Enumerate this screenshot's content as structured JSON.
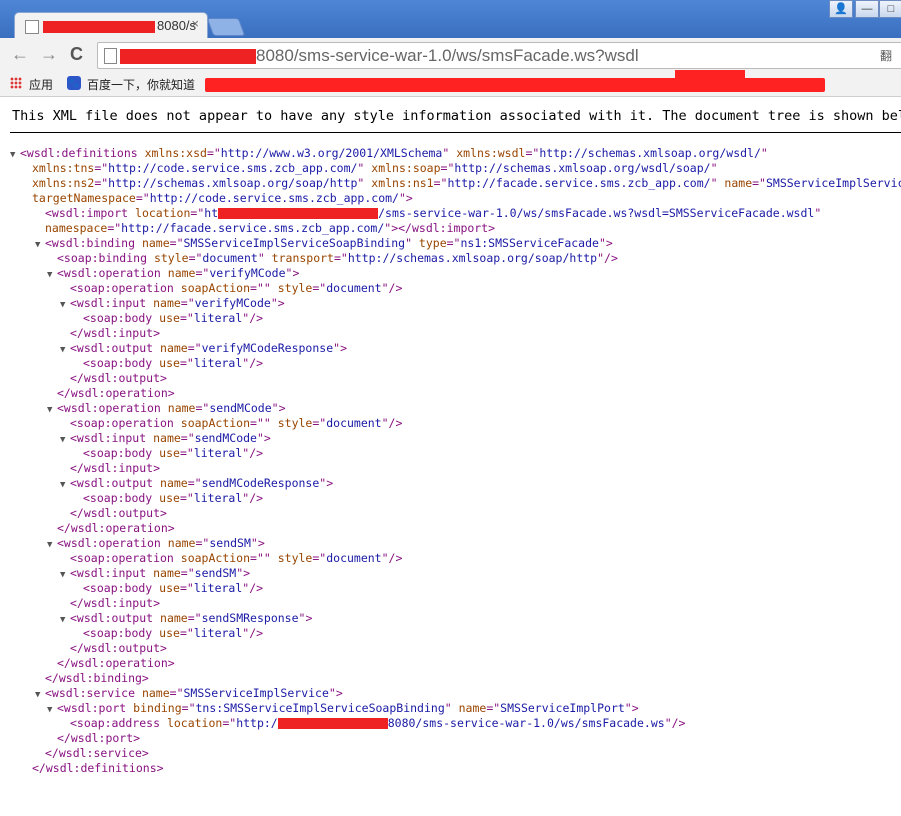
{
  "tab": {
    "title_suffix": "8080/s",
    "close": "×"
  },
  "window": {
    "user": "👤",
    "minimize": "—",
    "restore": "□"
  },
  "nav": {
    "back": "←",
    "forward": "→",
    "reload": "C"
  },
  "address": {
    "url_suffix": "8080/sms-service-war-1.0/ws/smsFacade.ws?wsdl",
    "translate_icon": "翻"
  },
  "bookmarks": {
    "apps_label": "应用",
    "baidu_label": "百度一下，你就知道"
  },
  "notice": "This XML file does not appear to have any style information associated with it. The document tree is shown below.",
  "xml": [
    {
      "indent": 0,
      "twisty": "▼",
      "parts": [
        [
          "tag",
          "<wsdl:definitions "
        ],
        [
          "attr",
          "xmlns:xsd"
        ],
        [
          "tag",
          "=\""
        ],
        [
          "val",
          "http://www.w3.org/2001/XMLSchema"
        ],
        [
          "tag",
          "\" "
        ],
        [
          "attr",
          "xmlns:wsdl"
        ],
        [
          "tag",
          "=\""
        ],
        [
          "val",
          "http://schemas.xmlsoap.org/wsdl/"
        ],
        [
          "tag",
          "\""
        ]
      ]
    },
    {
      "indent": 1,
      "twisty": "",
      "parts": [
        [
          "attr",
          "xmlns:tns"
        ],
        [
          "tag",
          "=\""
        ],
        [
          "val",
          "http://code.service.sms.zcb_app.com/"
        ],
        [
          "tag",
          "\" "
        ],
        [
          "attr",
          "xmlns:soap"
        ],
        [
          "tag",
          "=\""
        ],
        [
          "val",
          "http://schemas.xmlsoap.org/wsdl/soap/"
        ],
        [
          "tag",
          "\""
        ]
      ]
    },
    {
      "indent": 1,
      "twisty": "",
      "parts": [
        [
          "attr",
          "xmlns:ns2"
        ],
        [
          "tag",
          "=\""
        ],
        [
          "val",
          "http://schemas.xmlsoap.org/soap/http"
        ],
        [
          "tag",
          "\" "
        ],
        [
          "attr",
          "xmlns:ns1"
        ],
        [
          "tag",
          "=\""
        ],
        [
          "val",
          "http://facade.service.sms.zcb_app.com/"
        ],
        [
          "tag",
          "\" "
        ],
        [
          "attr",
          "name"
        ],
        [
          "tag",
          "=\""
        ],
        [
          "val",
          "SMSServiceImplService"
        ],
        [
          "tag",
          "\""
        ]
      ]
    },
    {
      "indent": 1,
      "twisty": "",
      "parts": [
        [
          "attr",
          "targetNamespace"
        ],
        [
          "tag",
          "=\""
        ],
        [
          "val",
          "http://code.service.sms.zcb_app.com/"
        ],
        [
          "tag",
          "\">"
        ]
      ]
    },
    {
      "indent": 2,
      "twisty": "",
      "parts": [
        [
          "tag",
          "<wsdl:import "
        ],
        [
          "attr",
          "location"
        ],
        [
          "tag",
          "=\""
        ],
        [
          "val",
          "ht"
        ],
        [
          "red",
          ""
        ],
        [
          "val",
          "/sms-service-war-1.0/ws/smsFacade.ws?wsdl=SMSServiceFacade.wsdl"
        ],
        [
          "tag",
          "\""
        ]
      ]
    },
    {
      "indent": 2,
      "twisty": "",
      "parts": [
        [
          "attr",
          "namespace"
        ],
        [
          "tag",
          "=\""
        ],
        [
          "val",
          "http://facade.service.sms.zcb_app.com/"
        ],
        [
          "tag",
          "\"></wsdl:import>"
        ]
      ]
    },
    {
      "indent": 2,
      "twisty": "▼",
      "parts": [
        [
          "tag",
          "<wsdl:binding "
        ],
        [
          "attr",
          "name"
        ],
        [
          "tag",
          "=\""
        ],
        [
          "val",
          "SMSServiceImplServiceSoapBinding"
        ],
        [
          "tag",
          "\" "
        ],
        [
          "attr",
          "type"
        ],
        [
          "tag",
          "=\""
        ],
        [
          "val",
          "ns1:SMSServiceFacade"
        ],
        [
          "tag",
          "\">"
        ]
      ]
    },
    {
      "indent": 3,
      "twisty": "",
      "parts": [
        [
          "tag",
          "<soap:binding "
        ],
        [
          "attr",
          "style"
        ],
        [
          "tag",
          "=\""
        ],
        [
          "val",
          "document"
        ],
        [
          "tag",
          "\" "
        ],
        [
          "attr",
          "transport"
        ],
        [
          "tag",
          "=\""
        ],
        [
          "val",
          "http://schemas.xmlsoap.org/soap/http"
        ],
        [
          "tag",
          "\"/>"
        ]
      ]
    },
    {
      "indent": 3,
      "twisty": "▼",
      "parts": [
        [
          "tag",
          "<wsdl:operation "
        ],
        [
          "attr",
          "name"
        ],
        [
          "tag",
          "=\""
        ],
        [
          "val",
          "verifyMCode"
        ],
        [
          "tag",
          "\">"
        ]
      ]
    },
    {
      "indent": 4,
      "twisty": "",
      "parts": [
        [
          "tag",
          "<soap:operation "
        ],
        [
          "attr",
          "soapAction"
        ],
        [
          "tag",
          "=\"\" "
        ],
        [
          "attr",
          "style"
        ],
        [
          "tag",
          "=\""
        ],
        [
          "val",
          "document"
        ],
        [
          "tag",
          "\"/>"
        ]
      ]
    },
    {
      "indent": 4,
      "twisty": "▼",
      "parts": [
        [
          "tag",
          "<wsdl:input "
        ],
        [
          "attr",
          "name"
        ],
        [
          "tag",
          "=\""
        ],
        [
          "val",
          "verifyMCode"
        ],
        [
          "tag",
          "\">"
        ]
      ]
    },
    {
      "indent": 5,
      "twisty": "",
      "parts": [
        [
          "tag",
          "<soap:body "
        ],
        [
          "attr",
          "use"
        ],
        [
          "tag",
          "=\""
        ],
        [
          "val",
          "literal"
        ],
        [
          "tag",
          "\"/>"
        ]
      ]
    },
    {
      "indent": 4,
      "twisty": "",
      "parts": [
        [
          "tag",
          "</wsdl:input>"
        ]
      ]
    },
    {
      "indent": 4,
      "twisty": "▼",
      "parts": [
        [
          "tag",
          "<wsdl:output "
        ],
        [
          "attr",
          "name"
        ],
        [
          "tag",
          "=\""
        ],
        [
          "val",
          "verifyMCodeResponse"
        ],
        [
          "tag",
          "\">"
        ]
      ]
    },
    {
      "indent": 5,
      "twisty": "",
      "parts": [
        [
          "tag",
          "<soap:body "
        ],
        [
          "attr",
          "use"
        ],
        [
          "tag",
          "=\""
        ],
        [
          "val",
          "literal"
        ],
        [
          "tag",
          "\"/>"
        ]
      ]
    },
    {
      "indent": 4,
      "twisty": "",
      "parts": [
        [
          "tag",
          "</wsdl:output>"
        ]
      ]
    },
    {
      "indent": 3,
      "twisty": "",
      "parts": [
        [
          "tag",
          "</wsdl:operation>"
        ]
      ]
    },
    {
      "indent": 3,
      "twisty": "▼",
      "parts": [
        [
          "tag",
          "<wsdl:operation "
        ],
        [
          "attr",
          "name"
        ],
        [
          "tag",
          "=\""
        ],
        [
          "val",
          "sendMCode"
        ],
        [
          "tag",
          "\">"
        ]
      ]
    },
    {
      "indent": 4,
      "twisty": "",
      "parts": [
        [
          "tag",
          "<soap:operation "
        ],
        [
          "attr",
          "soapAction"
        ],
        [
          "tag",
          "=\"\" "
        ],
        [
          "attr",
          "style"
        ],
        [
          "tag",
          "=\""
        ],
        [
          "val",
          "document"
        ],
        [
          "tag",
          "\"/>"
        ]
      ]
    },
    {
      "indent": 4,
      "twisty": "▼",
      "parts": [
        [
          "tag",
          "<wsdl:input "
        ],
        [
          "attr",
          "name"
        ],
        [
          "tag",
          "=\""
        ],
        [
          "val",
          "sendMCode"
        ],
        [
          "tag",
          "\">"
        ]
      ]
    },
    {
      "indent": 5,
      "twisty": "",
      "parts": [
        [
          "tag",
          "<soap:body "
        ],
        [
          "attr",
          "use"
        ],
        [
          "tag",
          "=\""
        ],
        [
          "val",
          "literal"
        ],
        [
          "tag",
          "\"/>"
        ]
      ]
    },
    {
      "indent": 4,
      "twisty": "",
      "parts": [
        [
          "tag",
          "</wsdl:input>"
        ]
      ]
    },
    {
      "indent": 4,
      "twisty": "▼",
      "parts": [
        [
          "tag",
          "<wsdl:output "
        ],
        [
          "attr",
          "name"
        ],
        [
          "tag",
          "=\""
        ],
        [
          "val",
          "sendMCodeResponse"
        ],
        [
          "tag",
          "\">"
        ]
      ]
    },
    {
      "indent": 5,
      "twisty": "",
      "parts": [
        [
          "tag",
          "<soap:body "
        ],
        [
          "attr",
          "use"
        ],
        [
          "tag",
          "=\""
        ],
        [
          "val",
          "literal"
        ],
        [
          "tag",
          "\"/>"
        ]
      ]
    },
    {
      "indent": 4,
      "twisty": "",
      "parts": [
        [
          "tag",
          "</wsdl:output>"
        ]
      ]
    },
    {
      "indent": 3,
      "twisty": "",
      "parts": [
        [
          "tag",
          "</wsdl:operation>"
        ]
      ]
    },
    {
      "indent": 3,
      "twisty": "▼",
      "parts": [
        [
          "tag",
          "<wsdl:operation "
        ],
        [
          "attr",
          "name"
        ],
        [
          "tag",
          "=\""
        ],
        [
          "val",
          "sendSM"
        ],
        [
          "tag",
          "\">"
        ]
      ]
    },
    {
      "indent": 4,
      "twisty": "",
      "parts": [
        [
          "tag",
          "<soap:operation "
        ],
        [
          "attr",
          "soapAction"
        ],
        [
          "tag",
          "=\"\" "
        ],
        [
          "attr",
          "style"
        ],
        [
          "tag",
          "=\""
        ],
        [
          "val",
          "document"
        ],
        [
          "tag",
          "\"/>"
        ]
      ]
    },
    {
      "indent": 4,
      "twisty": "▼",
      "parts": [
        [
          "tag",
          "<wsdl:input "
        ],
        [
          "attr",
          "name"
        ],
        [
          "tag",
          "=\""
        ],
        [
          "val",
          "sendSM"
        ],
        [
          "tag",
          "\">"
        ]
      ]
    },
    {
      "indent": 5,
      "twisty": "",
      "parts": [
        [
          "tag",
          "<soap:body "
        ],
        [
          "attr",
          "use"
        ],
        [
          "tag",
          "=\""
        ],
        [
          "val",
          "literal"
        ],
        [
          "tag",
          "\"/>"
        ]
      ]
    },
    {
      "indent": 4,
      "twisty": "",
      "parts": [
        [
          "tag",
          "</wsdl:input>"
        ]
      ]
    },
    {
      "indent": 4,
      "twisty": "▼",
      "parts": [
        [
          "tag",
          "<wsdl:output "
        ],
        [
          "attr",
          "name"
        ],
        [
          "tag",
          "=\""
        ],
        [
          "val",
          "sendSMResponse"
        ],
        [
          "tag",
          "\">"
        ]
      ]
    },
    {
      "indent": 5,
      "twisty": "",
      "parts": [
        [
          "tag",
          "<soap:body "
        ],
        [
          "attr",
          "use"
        ],
        [
          "tag",
          "=\""
        ],
        [
          "val",
          "literal"
        ],
        [
          "tag",
          "\"/>"
        ]
      ]
    },
    {
      "indent": 4,
      "twisty": "",
      "parts": [
        [
          "tag",
          "</wsdl:output>"
        ]
      ]
    },
    {
      "indent": 3,
      "twisty": "",
      "parts": [
        [
          "tag",
          "</wsdl:operation>"
        ]
      ]
    },
    {
      "indent": 2,
      "twisty": "",
      "parts": [
        [
          "tag",
          "</wsdl:binding>"
        ]
      ]
    },
    {
      "indent": 2,
      "twisty": "▼",
      "parts": [
        [
          "tag",
          "<wsdl:service "
        ],
        [
          "attr",
          "name"
        ],
        [
          "tag",
          "=\""
        ],
        [
          "val",
          "SMSServiceImplService"
        ],
        [
          "tag",
          "\">"
        ]
      ]
    },
    {
      "indent": 3,
      "twisty": "▼",
      "parts": [
        [
          "tag",
          "<wsdl:port "
        ],
        [
          "attr",
          "binding"
        ],
        [
          "tag",
          "=\""
        ],
        [
          "val",
          "tns:SMSServiceImplServiceSoapBinding"
        ],
        [
          "tag",
          "\" "
        ],
        [
          "attr",
          "name"
        ],
        [
          "tag",
          "=\""
        ],
        [
          "val",
          "SMSServiceImplPort"
        ],
        [
          "tag",
          "\">"
        ]
      ]
    },
    {
      "indent": 4,
      "twisty": "",
      "parts": [
        [
          "tag",
          "<soap:address "
        ],
        [
          "attr",
          "location"
        ],
        [
          "tag",
          "=\""
        ],
        [
          "val",
          "http:/"
        ],
        [
          "red",
          ""
        ],
        [
          "val",
          "8080/sms-service-war-1.0/ws/smsFacade.ws"
        ],
        [
          "tag",
          "\"/>"
        ]
      ]
    },
    {
      "indent": 3,
      "twisty": "",
      "parts": [
        [
          "tag",
          "</wsdl:port>"
        ]
      ]
    },
    {
      "indent": 2,
      "twisty": "",
      "parts": [
        [
          "tag",
          "</wsdl:service>"
        ]
      ]
    },
    {
      "indent": 1,
      "twisty": "",
      "parts": [
        [
          "tag",
          "</wsdl:definitions>"
        ]
      ]
    }
  ]
}
